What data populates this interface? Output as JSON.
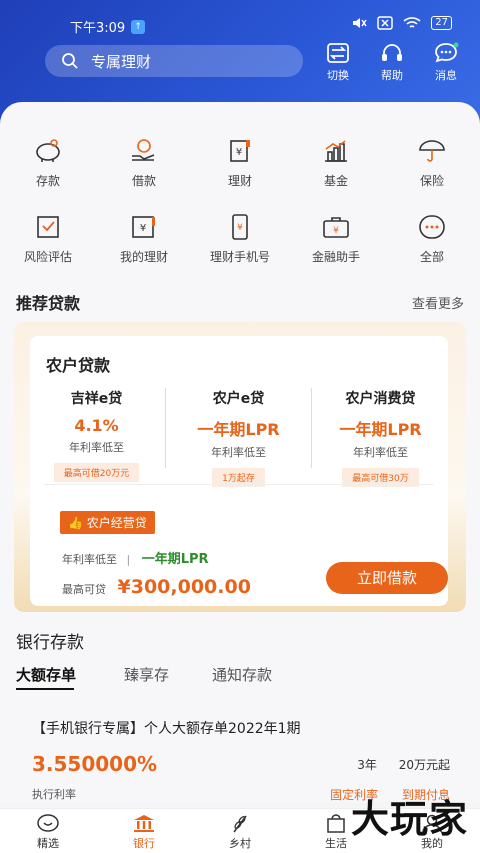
{
  "status_bar": {
    "time": "下午3:09",
    "battery": "27"
  },
  "header": {
    "search_placeholder": "专属理财",
    "buttons": [
      {
        "label": "切换",
        "icon": "switch-icon"
      },
      {
        "label": "帮助",
        "icon": "headset-icon"
      },
      {
        "label": "消息",
        "icon": "chat-icon"
      }
    ]
  },
  "menu": [
    {
      "label": "存款",
      "icon": "piggy-bank-icon"
    },
    {
      "label": "借款",
      "icon": "hand-coin-icon"
    },
    {
      "label": "理财",
      "icon": "finance-doc-icon"
    },
    {
      "label": "基金",
      "icon": "bar-chart-icon"
    },
    {
      "label": "保险",
      "icon": "umbrella-icon"
    },
    {
      "label": "风险评估",
      "icon": "checklist-icon"
    },
    {
      "label": "我的理财",
      "icon": "my-finance-icon"
    },
    {
      "label": "理财手机号",
      "icon": "phone-icon"
    },
    {
      "label": "金融助手",
      "icon": "briefcase-icon"
    },
    {
      "label": "全部",
      "icon": "more-icon"
    }
  ],
  "loans": {
    "section_title": "推荐贷款",
    "more": "查看更多",
    "card_title": "农户贷款",
    "products": [
      {
        "name": "吉祥e贷",
        "value": "4.1%",
        "sub": "年利率低至",
        "tag": "最高可借20万元"
      },
      {
        "name": "农户e贷",
        "value": "一年期LPR",
        "sub": "年利率低至",
        "tag": "1万起存"
      },
      {
        "name": "农户消费贷",
        "value": "一年期LPR",
        "sub": "年利率低至",
        "tag": "最高可借30万"
      }
    ],
    "featured": {
      "badge": "农户经营贷",
      "rate_label": "年利率低至",
      "rate_value": "一年期LPR",
      "max_label": "最高可贷",
      "max_value": "¥300,000.00",
      "button": "立即借款"
    }
  },
  "deposits": {
    "section_title": "银行存款",
    "tabs": [
      "大额存单",
      "臻享存",
      "通知存款"
    ],
    "product": {
      "name": "【手机银行专属】个人大额存单2022年1期",
      "rate": "3.550000%",
      "rate_label": "执行利率",
      "term": "3年",
      "min": "20万元起",
      "flag1": "固定利率",
      "flag2": "到期付息"
    }
  },
  "nav": [
    {
      "label": "精选",
      "icon": "home-icon"
    },
    {
      "label": "银行",
      "icon": "bank-icon"
    },
    {
      "label": "乡村",
      "icon": "wheat-icon"
    },
    {
      "label": "生活",
      "icon": "bag-icon"
    },
    {
      "label": "我的",
      "icon": "user-icon"
    }
  ],
  "watermark": "大玩家",
  "colors": {
    "primary_blue": "#2a57d6",
    "accent_orange": "#e8641b",
    "green": "#2e8b2e"
  }
}
